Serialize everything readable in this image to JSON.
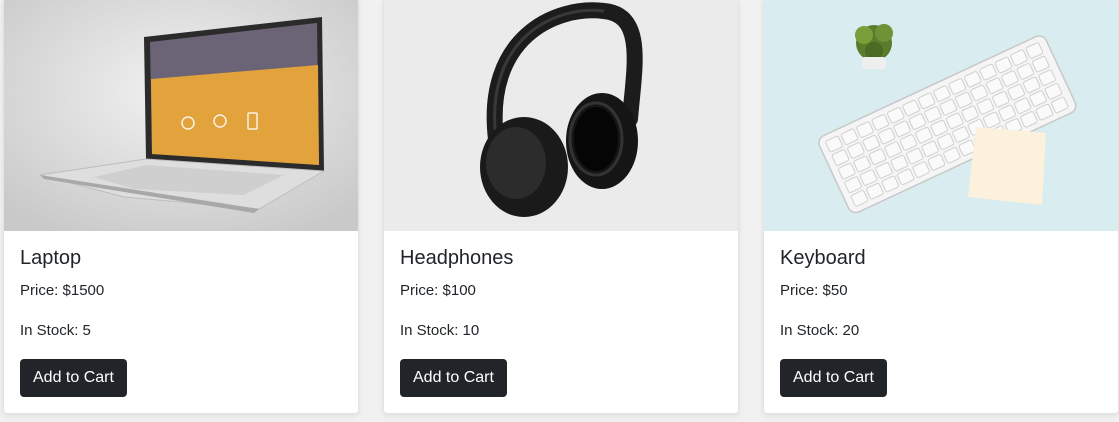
{
  "products": [
    {
      "name": "Laptop",
      "price_label": "Price: $1500",
      "stock_label": "In Stock: 5",
      "button_label": "Add to Cart",
      "image": "laptop-image"
    },
    {
      "name": "Headphones",
      "price_label": "Price: $100",
      "stock_label": "In Stock: 10",
      "button_label": "Add to Cart",
      "image": "headphones-image"
    },
    {
      "name": "Keyboard",
      "price_label": "Price: $50",
      "stock_label": "In Stock: 20",
      "button_label": "Add to Cart",
      "image": "keyboard-image"
    }
  ],
  "colors": {
    "button_bg": "#212529",
    "button_text": "#ffffff",
    "card_bg": "#ffffff",
    "page_bg": "#f1f1f1"
  }
}
